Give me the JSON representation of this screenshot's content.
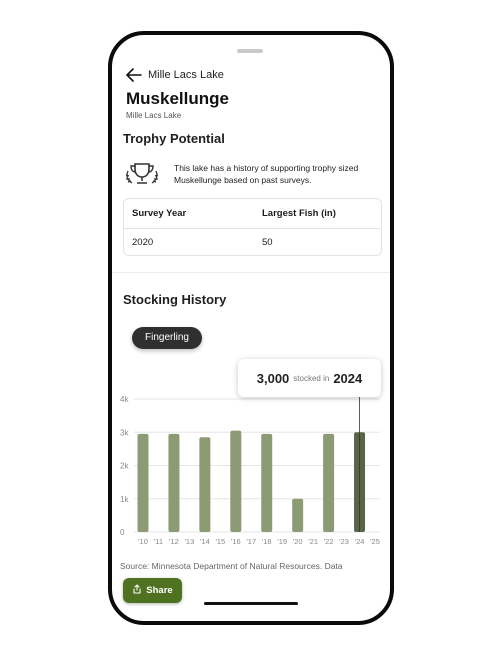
{
  "nav": {
    "back_icon": "arrow-left-icon",
    "title": "Mille Lacs Lake"
  },
  "header": {
    "title": "Muskellunge",
    "subtitle": "Mille Lacs Lake"
  },
  "trophy": {
    "section_title": "Trophy Potential",
    "icon": "trophy-laurel-icon",
    "description": "This lake has a history of supporting trophy sized Muskellunge based on past surveys.",
    "table": {
      "headers": [
        "Survey Year",
        "Largest Fish (in)"
      ],
      "rows": [
        [
          "2020",
          "50"
        ]
      ]
    }
  },
  "stocking": {
    "section_title": "Stocking History",
    "chip_label": "Fingerling",
    "tooltip": {
      "value": "3,000",
      "text": "stocked in",
      "year": "2024"
    },
    "source_text": "Source: Minnesota Department of Natural Resources. Data"
  },
  "chart_data": {
    "type": "bar",
    "categories": [
      "'10",
      "'12",
      "'14",
      "'16",
      "'18",
      "'20",
      "'22",
      "'24"
    ],
    "x_tick_labels": [
      "'10",
      "'11",
      "'12",
      "'13",
      "'14",
      "'15",
      "'16",
      "'17",
      "'18",
      "'19",
      "'20",
      "'21",
      "'22",
      "'23",
      "'24",
      "'25"
    ],
    "values": [
      2950,
      2950,
      2850,
      3050,
      2950,
      1000,
      2950,
      3000
    ],
    "y_ticks": [
      "0",
      "1k",
      "2k",
      "3k",
      "4k"
    ],
    "ylim": [
      0,
      4000
    ],
    "highlighted_category": "'24",
    "bar_color": "#8d9b74",
    "highlight_color": "#5a6548",
    "grid": true
  },
  "share": {
    "label": "Share",
    "icon": "share-icon"
  },
  "colors": {
    "accent": "#4f7222",
    "chip_bg": "#2f2f2f"
  }
}
